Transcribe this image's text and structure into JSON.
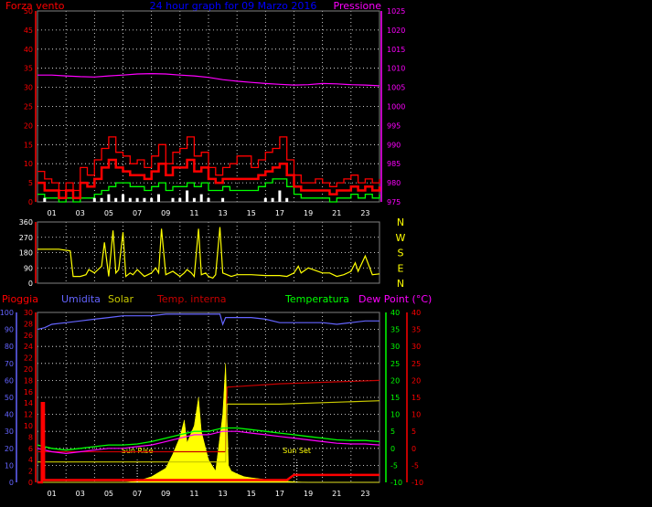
{
  "chart_data": [
    {
      "type": "line",
      "title": "24 hour graph for 09 Marzo 2016",
      "left_axis_title": "Forza vento",
      "right_axis_title": "Pressione",
      "x_ticks": [
        "01",
        "03",
        "05",
        "07",
        "09",
        "11",
        "13",
        "15",
        "17",
        "19",
        "21",
        "23"
      ],
      "xlim": [
        0,
        24
      ],
      "ylim_left": [
        0,
        50
      ],
      "left_ticks": [
        0,
        5,
        10,
        15,
        20,
        25,
        30,
        35,
        40,
        45,
        50
      ],
      "ylim_right": [
        975,
        1025
      ],
      "right_ticks": [
        975,
        980,
        985,
        990,
        995,
        1000,
        1005,
        1010,
        1015,
        1020,
        1025
      ],
      "grid": true,
      "colors": {
        "gust": "#ff0000",
        "wind": "#ff0000",
        "avg": "#00ff00",
        "windchill": "#ffffff",
        "pressure": "#ff00ff",
        "left_axis": "#ff0000",
        "right_axis": "#ff00ff",
        "title": "#0000ff"
      },
      "series": [
        {
          "key": "pressure",
          "axis": "right",
          "x": [
            0,
            1,
            2,
            3,
            4,
            5,
            6,
            7,
            8,
            9,
            10,
            11,
            12,
            13,
            14,
            15,
            16,
            17,
            18,
            19,
            20,
            21,
            22,
            23,
            24
          ],
          "values": [
            1008.2,
            1008.2,
            1008.0,
            1007.8,
            1007.7,
            1008.0,
            1008.2,
            1008.5,
            1008.6,
            1008.5,
            1008.2,
            1008.0,
            1007.6,
            1007.0,
            1006.6,
            1006.3,
            1006.0,
            1005.8,
            1005.6,
            1005.7,
            1006.0,
            1005.9,
            1005.7,
            1005.6,
            1005.4
          ]
        },
        {
          "key": "avg",
          "axis": "left",
          "x": [
            0,
            0.5,
            1,
            1.5,
            2,
            2.5,
            3,
            3.5,
            4,
            4.5,
            5,
            5.5,
            6,
            6.5,
            7,
            7.5,
            8,
            8.5,
            9,
            9.5,
            10,
            10.5,
            11,
            11.5,
            12,
            12.5,
            13,
            13.5,
            14,
            14.5,
            15,
            15.5,
            16,
            16.5,
            17,
            17.5,
            18,
            18.5,
            19,
            19.5,
            20,
            20.5,
            21,
            21.5,
            22,
            22.5,
            23,
            23.5,
            24
          ],
          "values": [
            2,
            1,
            1,
            0,
            1,
            0,
            1,
            1,
            2,
            3,
            4,
            5,
            5,
            4,
            4,
            3,
            4,
            5,
            3,
            4,
            4,
            5,
            4,
            5,
            3,
            3,
            4,
            3,
            3,
            3,
            3,
            4,
            5,
            6,
            6,
            4,
            2,
            1,
            1,
            1,
            1,
            0,
            1,
            1,
            2,
            1,
            2,
            1,
            2
          ]
        },
        {
          "key": "windchill",
          "axis": "left",
          "x": [
            0,
            0.5,
            1,
            1.5,
            2,
            2.5,
            3,
            3.5,
            4,
            4.5,
            5,
            5.5,
            6,
            6.5,
            7,
            7.5,
            8,
            8.5,
            9,
            9.5,
            10,
            10.5,
            11,
            11.5,
            12,
            12.5,
            13,
            13.5,
            14,
            14.5,
            15,
            15.5,
            16,
            16.5,
            17,
            17.5,
            18,
            18.5,
            19,
            19.5,
            20,
            20.5,
            21,
            21.5,
            22,
            22.5,
            23,
            23.5,
            24
          ],
          "values": [
            0,
            1,
            0,
            0,
            0,
            0,
            0,
            0,
            1,
            1,
            2,
            1,
            2,
            1,
            1,
            1,
            1,
            2,
            0,
            1,
            1,
            3,
            1,
            2,
            1,
            0,
            1,
            0,
            0,
            0,
            0,
            0,
            1,
            1,
            3,
            1,
            0,
            0,
            0,
            0,
            0,
            0,
            0,
            0,
            0,
            0,
            0,
            0,
            0
          ]
        },
        {
          "key": "wind",
          "axis": "left",
          "x": [
            0,
            0.5,
            1,
            1.5,
            2,
            2.5,
            3,
            3.5,
            4,
            4.5,
            5,
            5.5,
            6,
            6.5,
            7,
            7.5,
            8,
            8.5,
            9,
            9.5,
            10,
            10.5,
            11,
            11.5,
            12,
            12.5,
            13,
            13.5,
            14,
            14.5,
            15,
            15.5,
            16,
            16.5,
            17,
            17.5,
            18,
            18.5,
            19,
            19.5,
            20,
            20.5,
            21,
            21.5,
            22,
            22.5,
            23,
            23.5,
            24
          ],
          "values": [
            5,
            3,
            3,
            1,
            3,
            1,
            5,
            4,
            6,
            9,
            11,
            9,
            8,
            7,
            7,
            6,
            8,
            10,
            7,
            9,
            9,
            11,
            8,
            9,
            6,
            5,
            6,
            6,
            6,
            6,
            6,
            7,
            8,
            9,
            10,
            7,
            4,
            3,
            3,
            3,
            3,
            2,
            3,
            3,
            4,
            3,
            4,
            3,
            4
          ]
        },
        {
          "key": "gust",
          "axis": "left",
          "x": [
            0,
            0.5,
            1,
            1.5,
            2,
            2.5,
            3,
            3.5,
            4,
            4.5,
            5,
            5.5,
            6,
            6.5,
            7,
            7.5,
            8,
            8.5,
            9,
            9.5,
            10,
            10.5,
            11,
            11.5,
            12,
            12.5,
            13,
            13.5,
            14,
            14.5,
            15,
            15.5,
            16,
            16.5,
            17,
            17.5,
            18,
            18.5,
            19,
            19.5,
            20,
            20.5,
            21,
            21.5,
            22,
            22.5,
            23,
            23.5,
            24
          ],
          "values": [
            8,
            6,
            5,
            3,
            5,
            3,
            9,
            7,
            11,
            14,
            17,
            13,
            12,
            10,
            11,
            9,
            12,
            15,
            10,
            13,
            14,
            17,
            12,
            13,
            9,
            7,
            9,
            10,
            12,
            12,
            9,
            11,
            13,
            14,
            17,
            11,
            7,
            5,
            5,
            6,
            5,
            4,
            5,
            6,
            7,
            5,
            6,
            5,
            6
          ]
        }
      ]
    },
    {
      "type": "line",
      "x_ticks": [
        "01",
        "03",
        "05",
        "07",
        "09",
        "11",
        "13",
        "15",
        "17",
        "19",
        "21",
        "23"
      ],
      "xlim": [
        0,
        24
      ],
      "ylim": [
        0,
        360
      ],
      "left_ticks": [
        0,
        90,
        180,
        270,
        360
      ],
      "right_labels": [
        "N",
        "W",
        "S",
        "E",
        "N"
      ],
      "grid": true,
      "colors": {
        "line": "#ffff00",
        "left_axis": "#ff0000",
        "right_axis": "#ffff00"
      },
      "series": [
        {
          "key": "direction",
          "x": [
            0,
            1.5,
            2.3,
            2.5,
            3,
            3.4,
            3.6,
            4,
            4.5,
            4.7,
            5,
            5.3,
            5.5,
            5.7,
            6,
            6.2,
            6.5,
            6.7,
            7,
            7.5,
            8,
            8.3,
            8.5,
            8.7,
            9,
            9.5,
            10,
            10.3,
            10.5,
            10.8,
            11,
            11.3,
            11.5,
            11.8,
            12,
            12.3,
            12.5,
            12.8,
            13,
            13.3,
            13.6,
            14,
            14.5,
            15,
            16,
            17,
            17.5,
            18,
            18.3,
            18.5,
            19,
            20,
            20.5,
            21,
            21.5,
            22,
            22.3,
            22.5,
            23,
            23.5,
            24
          ],
          "values": [
            200,
            200,
            190,
            40,
            40,
            50,
            80,
            60,
            100,
            240,
            40,
            310,
            60,
            80,
            300,
            40,
            60,
            50,
            80,
            40,
            60,
            90,
            60,
            320,
            50,
            70,
            40,
            60,
            80,
            60,
            40,
            320,
            50,
            60,
            40,
            30,
            50,
            330,
            60,
            50,
            40,
            50,
            50,
            50,
            45,
            45,
            40,
            60,
            100,
            60,
            90,
            60,
            60,
            40,
            50,
            70,
            120,
            70,
            160,
            50,
            55
          ]
        }
      ]
    },
    {
      "type": "area",
      "labels": [
        "Pioggia",
        "Umidita",
        "Solar",
        "Temp. interna",
        "Temperatura",
        "Dew Point (°C)"
      ],
      "annotations": [
        "Sun Rise",
        "Sun Set"
      ],
      "x_ticks": [
        "01",
        "03",
        "05",
        "07",
        "09",
        "11",
        "13",
        "15",
        "17",
        "19",
        "21",
        "23"
      ],
      "xlim": [
        0,
        24
      ],
      "rain_axis": {
        "ticks": [
          0,
          2,
          4,
          6,
          8,
          10,
          12,
          14,
          16,
          18,
          20,
          22,
          24,
          26,
          28,
          30
        ],
        "ylim": [
          0,
          30
        ]
      },
      "hum_axis": {
        "ticks": [
          0,
          10,
          20,
          30,
          40,
          50,
          60,
          70,
          80,
          90,
          100
        ],
        "ylim": [
          0,
          100
        ]
      },
      "temp_axis": {
        "ticks": [
          -10,
          -5,
          0,
          5,
          10,
          15,
          20,
          25,
          30,
          35,
          40
        ],
        "ylim": [
          -10,
          40
        ]
      },
      "sunrise": 7,
      "sunset": 18.2,
      "grid": true,
      "colors": {
        "rain": "#ff0000",
        "humidity": "#6464ff",
        "solar": "#ffff00",
        "temp_int": "#c80000",
        "temperature": "#00ff00",
        "dewpoint": "#ff00ff",
        "humidity_axis": "#6464ff",
        "temp_axis": "#00ff00",
        "dew_axis": "#ff0000",
        "outdoor_humidity_band": "#c8c800"
      },
      "series": [
        {
          "key": "humidity",
          "axis": "hum",
          "x": [
            0,
            0.5,
            1,
            2,
            3,
            4,
            5,
            6,
            7,
            8,
            9,
            10,
            11,
            12,
            12.8,
            13,
            13.2,
            14,
            15,
            16,
            17,
            18,
            19,
            20,
            21,
            22,
            23,
            24
          ],
          "values": [
            90,
            91,
            93,
            94,
            95,
            96,
            97,
            98,
            98,
            98,
            99,
            99,
            99,
            99,
            99,
            93,
            97,
            97,
            97,
            96,
            94,
            94,
            94,
            94,
            93,
            94,
            95,
            95
          ]
        },
        {
          "key": "temp_int",
          "axis": "temp",
          "x": [
            0,
            13.2,
            13.3,
            17,
            24
          ],
          "values": [
            -1,
            -1,
            18,
            19,
            20
          ]
        },
        {
          "key": "outdoor_band",
          "axis": "temp",
          "x": [
            0,
            13.2,
            13.3,
            17,
            24
          ],
          "values": [
            -4,
            -4,
            13,
            13,
            14
          ]
        },
        {
          "key": "temperature",
          "axis": "temp",
          "x": [
            0,
            1,
            2,
            3,
            4,
            5,
            6,
            7,
            8,
            9,
            10,
            11,
            12,
            13,
            14,
            15,
            16,
            17,
            18,
            19,
            20,
            21,
            22,
            23,
            24
          ],
          "values": [
            1,
            0,
            -0.5,
            0,
            0.5,
            1,
            1,
            1.3,
            2,
            3,
            4,
            5,
            5,
            6,
            6,
            5.5,
            5,
            4.5,
            4,
            3.5,
            3,
            2.5,
            2.3,
            2.3,
            2
          ]
        },
        {
          "key": "dewpoint",
          "axis": "temp",
          "x": [
            0,
            1,
            2,
            3,
            4,
            5,
            6,
            7,
            8,
            9,
            10,
            11,
            12,
            13,
            14,
            15,
            16,
            17,
            18,
            19,
            20,
            21,
            22,
            23,
            24
          ],
          "values": [
            0,
            -1,
            -1.5,
            -1,
            -0.5,
            0,
            0,
            0.5,
            1,
            2,
            3,
            4,
            4,
            5,
            5,
            4.5,
            4,
            3.5,
            3,
            2.5,
            2,
            1.5,
            1.3,
            1.3,
            1
          ]
        },
        {
          "key": "solar",
          "axis": "rain",
          "x": [
            0,
            6,
            7,
            8,
            9,
            9.5,
            10,
            10.3,
            10.5,
            11,
            11.3,
            11.5,
            12,
            12.5,
            13,
            13.2,
            13.4,
            13.6,
            14,
            14.5,
            15,
            16,
            17,
            18,
            19,
            24
          ],
          "values": [
            0,
            0,
            0.2,
            1,
            2.5,
            5,
            8,
            11,
            7,
            10,
            15,
            9,
            4,
            2,
            12,
            21,
            3,
            2,
            1.5,
            1,
            0.8,
            0.5,
            0.3,
            0.1,
            0,
            0
          ]
        },
        {
          "key": "rain",
          "axis": "rain",
          "x": [
            0,
            0.3,
            0.31,
            0.45,
            0.46,
            17.5,
            18,
            24
          ],
          "values": [
            0,
            0,
            14,
            14,
            0.4,
            0.4,
            1.3,
            1.3
          ]
        }
      ]
    }
  ]
}
